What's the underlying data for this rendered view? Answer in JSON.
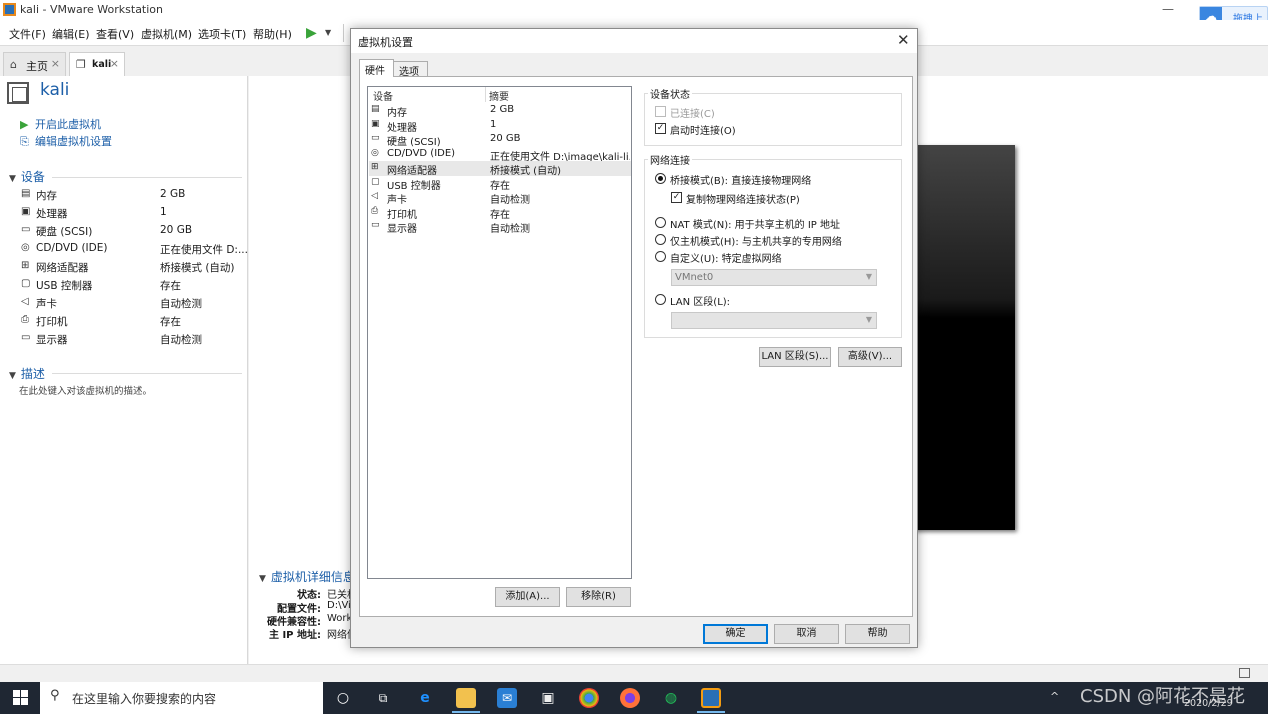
{
  "window": {
    "title": "kali - VMware Workstation"
  },
  "cloud_widget": {
    "label": "拖拽上传"
  },
  "menu": [
    "文件(F)",
    "编辑(E)",
    "查看(V)",
    "虚拟机(M)",
    "选项卡(T)",
    "帮助(H)"
  ],
  "tabs": [
    {
      "label": "主页",
      "icon": "home-icon"
    },
    {
      "label": "kali",
      "icon": "vm-icon"
    }
  ],
  "vm": {
    "name": "kali",
    "actions": [
      {
        "label": "开启此虚拟机",
        "icon": "play-icon"
      },
      {
        "label": "编辑虚拟机设置",
        "icon": "edit-icon"
      }
    ],
    "devices_header": "设备",
    "devices": [
      {
        "name": "内存",
        "value": "2 GB",
        "icon": "memory-icon"
      },
      {
        "name": "处理器",
        "value": "1",
        "icon": "cpu-icon"
      },
      {
        "name": "硬盘 (SCSI)",
        "value": "20 GB",
        "icon": "disk-icon"
      },
      {
        "name": "CD/DVD (IDE)",
        "value": "正在使用文件 D:...",
        "icon": "cdrom-icon"
      },
      {
        "name": "网络适配器",
        "value": "桥接模式 (自动)",
        "icon": "network-icon"
      },
      {
        "name": "USB 控制器",
        "value": "存在",
        "icon": "usb-icon"
      },
      {
        "name": "声卡",
        "value": "自动检测",
        "icon": "sound-icon"
      },
      {
        "name": "打印机",
        "value": "存在",
        "icon": "printer-icon"
      },
      {
        "name": "显示器",
        "value": "自动检测",
        "icon": "display-icon"
      }
    ],
    "description_header": "描述",
    "description_placeholder": "在此处键入对该虚拟机的描述。",
    "details_header": "虚拟机详细信息",
    "details": [
      {
        "key": "状态:",
        "value": "已关机"
      },
      {
        "key": "配置文件:",
        "value": "D:\\Vi"
      },
      {
        "key": "硬件兼容性:",
        "value": "Work"
      },
      {
        "key": "主 IP 地址:",
        "value": "网络信"
      }
    ]
  },
  "dialog": {
    "title": "虚拟机设置",
    "tabs": [
      "硬件",
      "选项"
    ],
    "list_headers": {
      "device": "设备",
      "summary": "摘要"
    },
    "devices": [
      {
        "name": "内存",
        "value": "2 GB",
        "icon": "memory-icon"
      },
      {
        "name": "处理器",
        "value": "1",
        "icon": "cpu-icon"
      },
      {
        "name": "硬盘 (SCSI)",
        "value": "20 GB",
        "icon": "disk-icon"
      },
      {
        "name": "CD/DVD (IDE)",
        "value": "正在使用文件 D:\\image\\kali-li...",
        "icon": "cdrom-icon"
      },
      {
        "name": "网络适配器",
        "value": "桥接模式 (自动)",
        "icon": "network-icon",
        "selected": true
      },
      {
        "name": "USB 控制器",
        "value": "存在",
        "icon": "usb-icon"
      },
      {
        "name": "声卡",
        "value": "自动检测",
        "icon": "sound-icon"
      },
      {
        "name": "打印机",
        "value": "存在",
        "icon": "printer-icon"
      },
      {
        "name": "显示器",
        "value": "自动检测",
        "icon": "display-icon"
      }
    ],
    "add_button": "添加(A)...",
    "remove_button": "移除(R)",
    "device_status": {
      "title": "设备状态",
      "connected": {
        "label": "已连接(C)",
        "checked": false,
        "disabled": true
      },
      "connect_at_power_on": {
        "label": "启动时连接(O)",
        "checked": true
      }
    },
    "network": {
      "title": "网络连接",
      "bridged": {
        "label": "桥接模式(B): 直接连接物理网络",
        "selected": true
      },
      "replicate": {
        "label": "复制物理网络连接状态(P)",
        "checked": true
      },
      "nat": {
        "label": "NAT 模式(N): 用于共享主机的 IP 地址"
      },
      "host_only": {
        "label": "仅主机模式(H): 与主机共享的专用网络"
      },
      "custom": {
        "label": "自定义(U): 特定虚拟网络"
      },
      "custom_select": "VMnet0",
      "lan_segment": {
        "label": "LAN 区段(L):"
      },
      "lan_select": ""
    },
    "lan_segments_button": "LAN 区段(S)...",
    "advanced_button": "高级(V)...",
    "ok_button": "确定",
    "cancel_button": "取消",
    "help_button": "帮助"
  },
  "taskbar": {
    "search_placeholder": "在这里输入你要搜索的内容",
    "date": "2020/2/29"
  },
  "watermark": "CSDN @阿花不是花",
  "colors": {
    "accent": "#1d5fa8",
    "taskbar": "#1f2733",
    "focus": "#0078d7"
  }
}
